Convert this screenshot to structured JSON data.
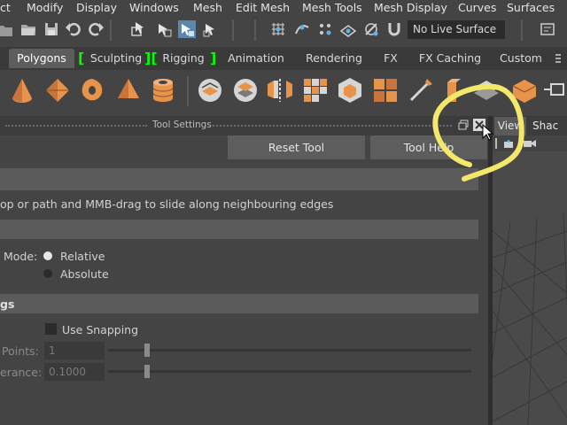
{
  "menubar": {
    "items": [
      "ct",
      "Modify",
      "Display",
      "Windows",
      "Mesh",
      "Edit Mesh",
      "Mesh Tools",
      "Mesh Display",
      "Curves",
      "Surfaces"
    ]
  },
  "toolbar": {
    "live_surface": "No Live Surface"
  },
  "shelf_tabs": {
    "polygons": "Polygons",
    "sculpting": "Sculpting",
    "rigging": "Rigging",
    "animation": "Animation",
    "rendering": "Rendering",
    "fx": "FX",
    "fx_caching": "FX Caching",
    "custom": "Custom",
    "bracket_open": "[",
    "bracket_close": "]",
    "bracket_mid": "]["
  },
  "tool_settings": {
    "title": "Tool Settings",
    "reset_tool": "Reset Tool",
    "tool_help": "Tool Help",
    "instruction": "op or path and MMB-drag to slide along neighbouring edges",
    "mode_label": "Mode:",
    "relative": "Relative",
    "absolute": "Absolute",
    "snapping_section": "gs",
    "use_snapping": "Use Snapping",
    "points_label": "Points:",
    "points_value": "1",
    "tolerance_label": "erance:",
    "tolerance_value": "0.1000"
  },
  "viewport": {
    "view_tab": "View",
    "shading_tab": "Shac"
  },
  "colors": {
    "accent_orange": "#e8934a",
    "annotation_yellow": "#f3e869",
    "bracket_green": "#00ff00"
  }
}
